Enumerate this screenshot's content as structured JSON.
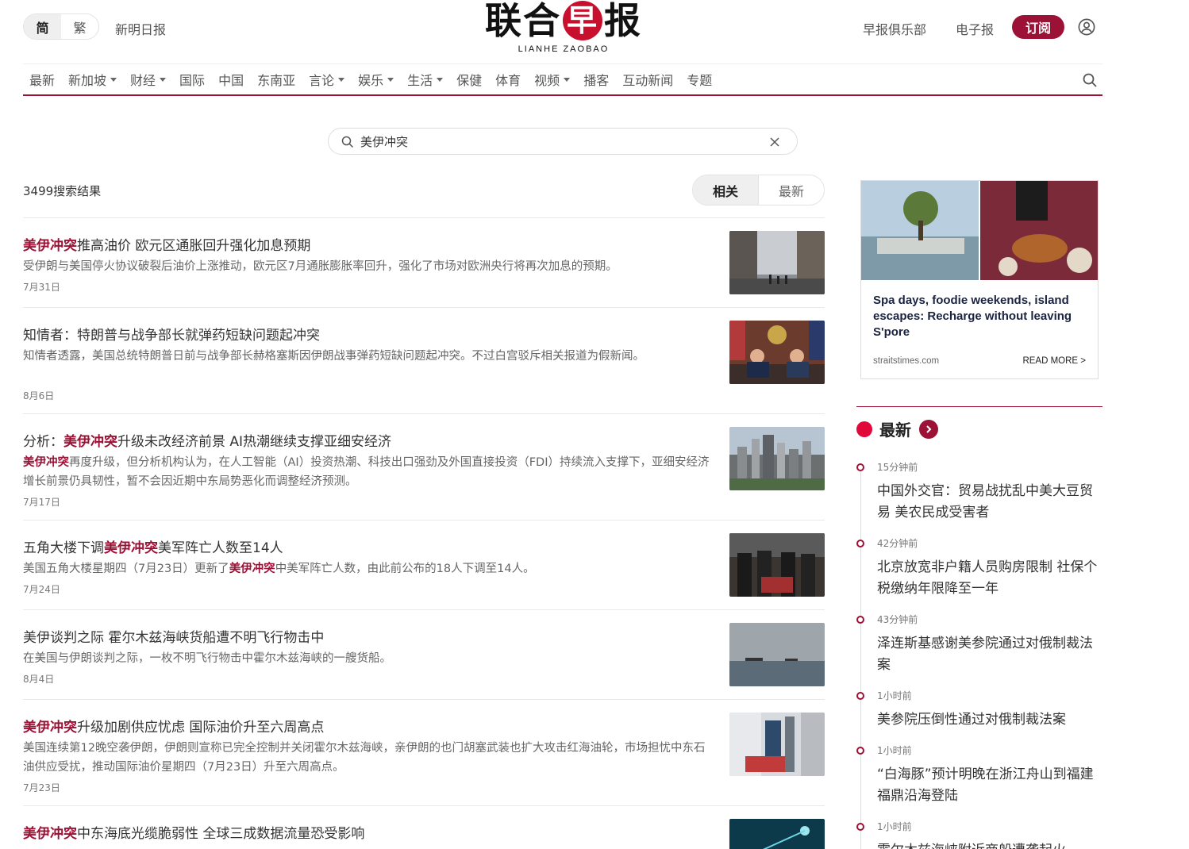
{
  "header": {
    "lang_simplified": "简",
    "lang_traditional": "繁",
    "xinming": "新明日报",
    "logo_cn_1": "联合",
    "logo_cn_2": "早",
    "logo_cn_3": "报",
    "logo_en": "LIANHE ZAOBAO",
    "club": "早报俱乐部",
    "epaper": "电子报",
    "subscribe": "订阅"
  },
  "nav": [
    {
      "label": "最新",
      "dropdown": false
    },
    {
      "label": "新加坡",
      "dropdown": true
    },
    {
      "label": "财经",
      "dropdown": true
    },
    {
      "label": "国际",
      "dropdown": false
    },
    {
      "label": "中国",
      "dropdown": false
    },
    {
      "label": "东南亚",
      "dropdown": false
    },
    {
      "label": "言论",
      "dropdown": true
    },
    {
      "label": "娱乐",
      "dropdown": true
    },
    {
      "label": "生活",
      "dropdown": true
    },
    {
      "label": "保健",
      "dropdown": false
    },
    {
      "label": "体育",
      "dropdown": false
    },
    {
      "label": "视频",
      "dropdown": true
    },
    {
      "label": "播客",
      "dropdown": false
    },
    {
      "label": "互动新闻",
      "dropdown": false
    },
    {
      "label": "专题",
      "dropdown": false
    }
  ],
  "search": {
    "value": "美伊冲突"
  },
  "results_header": {
    "count": "3499搜索结果",
    "sort_relevant": "相关",
    "sort_latest": "最新"
  },
  "results": [
    {
      "title_pre": "",
      "title_hl": "美伊冲突",
      "title_post": "推高油价 欧元区通胀回升强化加息预期",
      "desc_pre": "受伊朗与美国停火协议破裂后油价上涨推动，欧元区7月通胀膨胀率回升，强化了市场对欧洲央行将再次加息的预期。",
      "desc_hl": "",
      "desc_post": "",
      "date": "7月31日"
    },
    {
      "title_pre": "知情者：特朗普与战争部长就弹药短缺问题起冲突",
      "title_hl": "",
      "title_post": "",
      "desc_pre": "知情者透露，美国总统特朗普日前与战争部长赫格塞斯因伊朗战事弹药短缺问题起冲突。不过白宫驳斥相关报道为假新闻。",
      "desc_hl": "",
      "desc_post": "",
      "date": "8月6日"
    },
    {
      "title_pre": "分析：",
      "title_hl": "美伊冲突",
      "title_post": "升级未改经济前景 AI热潮继续支撑亚细安经济",
      "desc_pre": "",
      "desc_hl": "美伊冲突",
      "desc_post": "再度升级，但分析机构认为，在人工智能（AI）投资热潮、科技出口强劲及外国直接投资（FDI）持续流入支撑下，亚细安经济增长前景仍具韧性，暂不会因近期中东局势恶化而调整经济预测。",
      "date": "7月17日"
    },
    {
      "title_pre": "五角大楼下调",
      "title_hl": "美伊冲突",
      "title_post": "美军阵亡人数至14人",
      "desc_pre": "美国五角大楼星期四（7月23日）更新了",
      "desc_hl": "美伊冲突",
      "desc_post": "中美军阵亡人数，由此前公布的18人下调至14人。",
      "date": "7月24日"
    },
    {
      "title_pre": "美伊谈判之际 霍尔木兹海峡货船遭不明飞行物击中",
      "title_hl": "",
      "title_post": "",
      "desc_pre": "在美国与伊朗谈判之际，一枚不明飞行物击中霍尔木兹海峡的一艘货船。",
      "desc_hl": "",
      "desc_post": "",
      "date": "8月4日"
    },
    {
      "title_pre": "",
      "title_hl": "美伊冲突",
      "title_post": "升级加剧供应忧虑 国际油价升至六周高点",
      "desc_pre": "美国连续第12晚空袭伊朗，伊朗则宣称已完全控制并关闭霍尔木兹海峡，亲伊朗的也门胡塞武装也扩大攻击红海油轮，市场担忧中东石油供应受扰，推动国际油价星期四（7月23日）升至六周高点。",
      "desc_hl": "",
      "desc_post": "",
      "date": "7月23日"
    },
    {
      "title_pre": "",
      "title_hl": "美伊冲突",
      "title_post": "中东海底光缆脆弱性 全球三成数据流量恐受影响",
      "desc_pre": "",
      "desc_hl": "",
      "desc_post": "",
      "date": ""
    }
  ],
  "ad": {
    "title": "Spa days, foodie weekends, island escapes: Recharge without leaving S'pore",
    "source": "straitstimes.com",
    "more": "READ MORE >"
  },
  "latest": {
    "label": "最新",
    "items": [
      {
        "time": "15分钟前",
        "title": "中国外交官：贸易战扰乱中美大豆贸易 美农民成受害者"
      },
      {
        "time": "42分钟前",
        "title": "北京放宽非户籍人员购房限制 社保个税缴纳年限降至一年"
      },
      {
        "time": "43分钟前",
        "title": "泽连斯基感谢美参院通过对俄制裁法案"
      },
      {
        "time": "1小时前",
        "title": "美参院压倒性通过对俄制裁法案"
      },
      {
        "time": "1小时前",
        "title": "“白海豚”预计明晚在浙江舟山到福建福鼎沿海登陆"
      },
      {
        "time": "1小时前",
        "title": "霍尔木兹海峡附近商船遭袭起火"
      }
    ]
  },
  "colors": {
    "brand": "#9b1236",
    "highlight": "#9b1236",
    "accent_dot": "#e0093a"
  }
}
